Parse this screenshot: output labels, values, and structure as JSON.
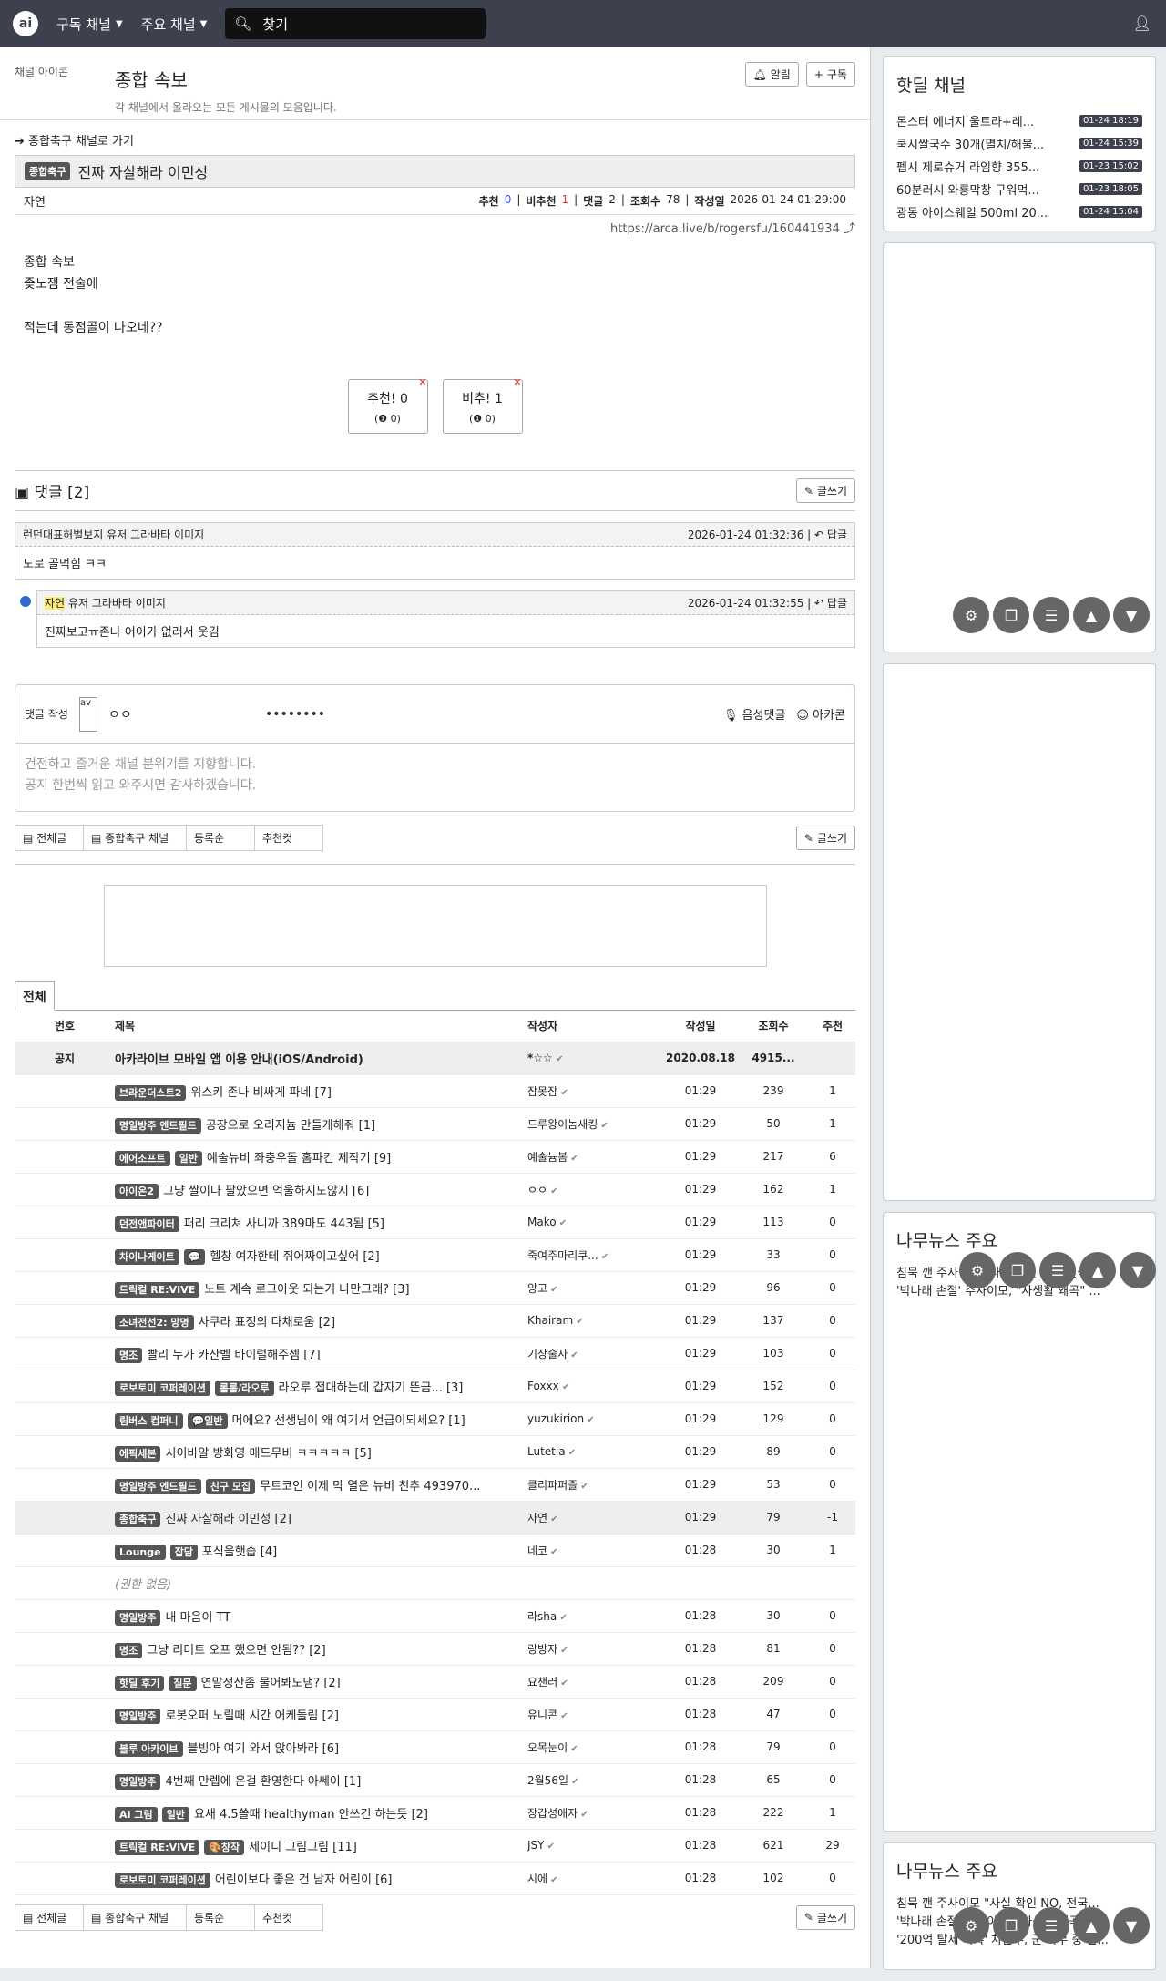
{
  "nav": {
    "logo": "ai",
    "sub_channels": "구독 채널",
    "main_channels": "주요 채널",
    "search_placeholder": "찾기"
  },
  "channel": {
    "img_alt": "채널 아이콘",
    "title": "종합 속보",
    "desc": "각 채널에서 올라오는 모든 게시물의 모음입니다.",
    "alarm": "알림",
    "subscribe": "구독"
  },
  "article": {
    "back": "종합축구 채널로 가기",
    "category": "종합축구",
    "title": "진짜 자살해라 이민성",
    "author": "자연",
    "rec_label": "추천",
    "rec": "0",
    "nrec_label": "비추천",
    "nrec": "1",
    "cmt_label": "댓글",
    "cmt": "2",
    "views_label": "조회수",
    "views": "78",
    "date_label": "작성일",
    "date": "2026-01-24 01:29:00",
    "url": "https://arca.live/b/rogersfu/160441934",
    "img_alt": "종합 속보",
    "line1": "좆노잼 전술에",
    "line2": "적는데 동점골이 나오네??",
    "vote_up": "추천!",
    "vote_up_n": "0",
    "vote_up_sub": "(❶ 0)",
    "vote_down": "비추!",
    "vote_down_n": "1",
    "vote_down_sub": "(❶ 0)"
  },
  "comments": {
    "header": "댓글 [2]",
    "write": "글쓰기",
    "items": [
      {
        "author": "런던대표허벌보지",
        "avatar": "유저 그라바타 이미지",
        "date": "2026-01-24 01:32:36",
        "reply": "답글",
        "text": "도로 골먹힘 ㅋㅋ"
      },
      {
        "author": "자연",
        "avatar": "유저 그라바타 이미지",
        "date": "2026-01-24 01:32:55",
        "reply": "답글",
        "text": "진짜보고ㅠ존나 어이가 없러서 웃김"
      }
    ]
  },
  "compose": {
    "label": "댓글 작성",
    "avatar": "av",
    "nick": "ㅇㅇ",
    "pw": "••••••••",
    "voice": "음성댓글",
    "arcacon": "아카콘",
    "placeholder1": "건전하고 즐거운 채널 분위기를 지향합니다.",
    "placeholder2": "공지 한번씩 읽고 와주시면 감사하겠습니다."
  },
  "listtabs": {
    "all": "전체글",
    "channel": "종합축구 채널",
    "sort": "등록순",
    "best": "추천컷",
    "write": "글쓰기",
    "tab_all": "전체"
  },
  "table": {
    "headers": [
      "번호",
      "제목",
      "작성자",
      "작성일",
      "조회수",
      "추천"
    ],
    "notice": {
      "label": "공지",
      "title": "아카라이브 모바일 앱 이용 안내(iOS/Android)",
      "author": "*☆☆",
      "date": "2020.08.18",
      "views": "4915...",
      "rec": ""
    },
    "rows": [
      {
        "badges": [
          "브라운더스트2"
        ],
        "title": "위스키 존나 비싸게 파네 [7]",
        "author": "잠못잠",
        "date": "01:29",
        "views": "239",
        "rec": "1"
      },
      {
        "badges": [
          "명일방주 엔드필드"
        ],
        "title": "공장으로 오리지늄 만들게해줘 [1]",
        "author": "드루왕이놈새킹",
        "date": "01:29",
        "views": "50",
        "rec": "1"
      },
      {
        "badges": [
          "에어소프트",
          "일반"
        ],
        "title": "예술뉴비 좌충우돌 홈파킨 제작기 [9]",
        "author": "예술늄봄",
        "date": "01:29",
        "views": "217",
        "rec": "6"
      },
      {
        "badges": [
          "아이온2"
        ],
        "title": "그냥 쌀이나 팔았으면 억울하지도않지 [6]",
        "author": "ㅇㅇ",
        "date": "01:29",
        "views": "162",
        "rec": "1"
      },
      {
        "badges": [
          "던전앤파이터"
        ],
        "title": "퍼리 크리쳐 사니까 389마도 443됨 [5]",
        "author": "Mako",
        "date": "01:29",
        "views": "113",
        "rec": "0"
      },
      {
        "badges": [
          "차이나게이트",
          "💬"
        ],
        "title": "헬창 여자한테 쥐어짜이고싶어 [2]",
        "author": "죽여주마리쿠...",
        "date": "01:29",
        "views": "33",
        "rec": "0"
      },
      {
        "badges": [
          "트릭컬 RE:VIVE"
        ],
        "title": "노트 계속 로그아웃 되는거 나만그래? [3]",
        "author": "앙고",
        "date": "01:29",
        "views": "96",
        "rec": "0"
      },
      {
        "badges": [
          "소녀전선2: 망명"
        ],
        "title": "사쿠라 표정의 다채로움 [2]",
        "author": "Khairam",
        "date": "01:29",
        "views": "137",
        "rec": "0"
      },
      {
        "badges": [
          "명조"
        ],
        "title": "빨리 누가 카산벨 바이럴해주셈 [7]",
        "author": "기상술사",
        "date": "01:29",
        "views": "103",
        "rec": "0"
      },
      {
        "badges": [
          "로보토미 코퍼레이션",
          "롬롬/라오루"
        ],
        "title": "라오루 접대하는데 갑자기 뜬금... [3]",
        "author": "Foxxx",
        "date": "01:29",
        "views": "152",
        "rec": "0"
      },
      {
        "badges": [
          "림버스 컴퍼니",
          "💬일반"
        ],
        "title": "머에요? 선생님이 왜 여기서 언급이되세요? [1]",
        "author": "yuzukirion",
        "date": "01:29",
        "views": "129",
        "rec": "0"
      },
      {
        "badges": [
          "에픽세븐"
        ],
        "title": "시이바알 방화영 매드무비 ㅋㅋㅋㅋㅋ [5]",
        "author": "Lutetia",
        "date": "01:29",
        "views": "89",
        "rec": "0"
      },
      {
        "badges": [
          "명일방주 엔드필드",
          "친구 모집"
        ],
        "title": "무트코인 이제 막 열은 뉴비 친추 493970...",
        "author": "클리파퍼즐",
        "date": "01:29",
        "views": "53",
        "rec": "0"
      },
      {
        "badges": [
          "종합축구"
        ],
        "title": "진짜 자살해라 이민성 [2]",
        "author": "자연",
        "date": "01:29",
        "views": "79",
        "rec": "-1",
        "hl": true
      },
      {
        "badges": [
          "Lounge",
          "잡담"
        ],
        "title": "포식을햇습 [4]",
        "author": "네코",
        "date": "01:28",
        "views": "30",
        "rec": "1"
      },
      {
        "badges": [],
        "title": "(권한 없음)",
        "author": "",
        "date": "",
        "views": "",
        "rec": ""
      },
      {
        "badges": [
          "명일방주"
        ],
        "title": "내 마음이 TT",
        "author": "라sha",
        "date": "01:28",
        "views": "30",
        "rec": "0"
      },
      {
        "badges": [
          "명조"
        ],
        "title": "그냥 리미트 오프 했으면 안됨?? [2]",
        "author": "랑방자",
        "date": "01:28",
        "views": "81",
        "rec": "0"
      },
      {
        "badges": [
          "핫딜 후기",
          "질문"
        ],
        "title": "연말정산좀 물어봐도댐? [2]",
        "author": "요챈러",
        "date": "01:28",
        "views": "209",
        "rec": "0"
      },
      {
        "badges": [
          "명일방주"
        ],
        "title": "로봇오퍼 노릴때 시간 어케돌림 [2]",
        "author": "유니콘",
        "date": "01:28",
        "views": "47",
        "rec": "0"
      },
      {
        "badges": [
          "블루 아카이브"
        ],
        "title": "블빙아 여기 와서 앉아봐라 [6]",
        "author": "오목눈이",
        "date": "01:28",
        "views": "79",
        "rec": "0"
      },
      {
        "badges": [
          "명일방주"
        ],
        "title": "4번째 만렙에 온걸 환영한다 아쎄이 [1]",
        "author": "2월56일",
        "date": "01:28",
        "views": "65",
        "rec": "0"
      },
      {
        "badges": [
          "AI 그림",
          "일반"
        ],
        "title": "요새 4.5쓸때 healthyman 안쓰긴 하는듯 [2]",
        "author": "장갑성애자",
        "date": "01:28",
        "views": "222",
        "rec": "1"
      },
      {
        "badges": [
          "트릭컬 RE:VIVE",
          "🎨창작"
        ],
        "title": "세이디 그림그림 [11]",
        "author": "JSY",
        "date": "01:28",
        "views": "621",
        "rec": "29"
      },
      {
        "badges": [
          "로보토미 코퍼레이션"
        ],
        "title": "어린이보다 좋은 건 남자 어린이 [6]",
        "author": "시에",
        "date": "01:28",
        "views": "102",
        "rec": "0"
      }
    ]
  },
  "side": {
    "hot_title": "핫딜 채널",
    "hot": [
      {
        "t": "몬스터 에너지 울트라+레...",
        "d": "01-24 18:19"
      },
      {
        "t": "쿡시쌀국수 30개(멸치/해물...",
        "d": "01-24 15:39"
      },
      {
        "t": "펩시 제로슈거 라임향 355...",
        "d": "01-23 15:02"
      },
      {
        "t": "60분러시 와룡막창 구워먹...",
        "d": "01-23 18:05"
      },
      {
        "t": "광동 아이스웨일 500ml 20...",
        "d": "01-24 15:04"
      }
    ],
    "news_title": "나무뉴스 주요",
    "news": [
      "침묵 깬 주사이모 \"사실 확인 NO, 전국...",
      "'박나래 손절' 주사이모, \"사생활 왜곡\" ..."
    ],
    "news2_title": "나무뉴스 주요",
    "news2": [
      "침묵 깬 주사이모 \"사실 확인 NO, 전국...",
      "'박나래 손절' 주사이모, \"사생활 왜곡\" ...",
      "'200억 탈세 의혹' 차은우, 군 복무 중 입..."
    ]
  }
}
